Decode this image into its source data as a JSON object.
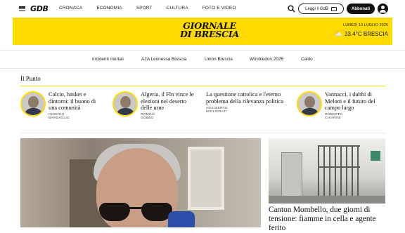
{
  "header": {
    "logo": "GDB",
    "nav": [
      "CRONACA",
      "ECONOMIA",
      "SPORT",
      "CULTURA",
      "FOTO E VIDEO"
    ],
    "read_button": "Leggi il GdB",
    "subscribe_button": "Abbonati"
  },
  "masthead": {
    "line1": "GIORNALE",
    "line2": "DI BRESCIA",
    "date": "LUNEDÌ 13 LUGLIO 2026",
    "weather": "33.4°C BRESCIA"
  },
  "tags": [
    "Incidenti mortali",
    "A2A Leonessa Brescia",
    "Union Brescia",
    "Wimbledon 2026",
    "Caldo"
  ],
  "il_punto": {
    "title": "Il Punto",
    "items": [
      {
        "headline": "Calcio, basket e dintorni: il buono di una comunità",
        "author": "GIORGIO BARDAGLIO"
      },
      {
        "headline": "Algeria, il Fln vince le elezioni nel deserto delle urne",
        "author": "ROMINA GOBBO"
      },
      {
        "headline": "La questione cattolica e l'eterno problema della rilevanza politica",
        "author": "ADALBERTO MIGLIORATI"
      },
      {
        "headline": "Vannacci, i dubbi di Meloni e il futuro del campo largo",
        "author": "ROBERTO CHIARINI"
      }
    ]
  },
  "articles": {
    "side_headline": "Canton Mombello, due giorni di tensione: fiamme in cella e agente ferito"
  },
  "colors": {
    "accent": "#ffdb00"
  }
}
